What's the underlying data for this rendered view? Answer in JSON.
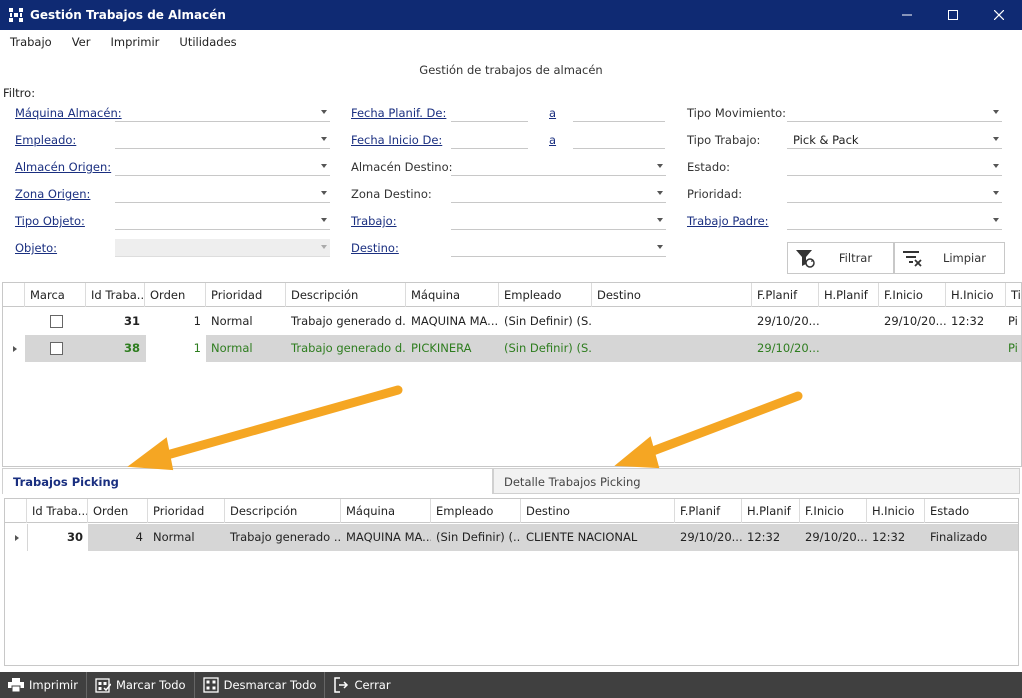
{
  "window": {
    "title": "Gestión Trabajos de Almacén"
  },
  "menu": [
    "Trabajo",
    "Ver",
    "Imprimir",
    "Utilidades"
  ],
  "form_title": "Gestión de trabajos de almacén",
  "filter": {
    "label": "Filtro:",
    "maquina_almacen": "Máquina Almacén:",
    "empleado": "Empleado:",
    "almacen_origen": "Almacén Origen:",
    "zona_origen": "Zona Origen:",
    "tipo_objeto": "Tipo Objeto:",
    "objeto": "Objeto:",
    "fecha_planif_de": "Fecha Planif. De:",
    "fecha_inicio_de": "Fecha Inicio De:",
    "a": "a",
    "almacen_destino": "Almacén Destino:",
    "zona_destino": "Zona Destino:",
    "trabajo": "Trabajo:",
    "destino": "Destino:",
    "tipo_movimiento": "Tipo Movimiento:",
    "tipo_trabajo": "Tipo Trabajo:",
    "tipo_trabajo_value": "Pick & Pack",
    "estado": "Estado:",
    "prioridad": "Prioridad:",
    "trabajo_padre": "Trabajo Padre:",
    "filtrar": "Filtrar",
    "limpiar": "Limpiar"
  },
  "top_grid": {
    "headers": [
      "Marca",
      "Id Traba...",
      "Orden",
      "Prioridad",
      "Descripción",
      "Máquina",
      "Empleado",
      "Destino",
      "F.Planif",
      "H.Planif",
      "F.Inicio",
      "H.Inicio",
      "Ti"
    ],
    "rows": [
      {
        "id": "31",
        "orden": "1",
        "prioridad": "Normal",
        "descripcion": "Trabajo generado d...",
        "maquina": "MAQUINA MA...",
        "empleado": "(Sin Definir) (S...",
        "destino": "",
        "f_planif": "29/10/20...",
        "h_planif": "",
        "f_inicio": "29/10/20...",
        "h_inicio": "12:32",
        "ti": "Pi"
      },
      {
        "id": "38",
        "orden": "1",
        "prioridad": "Normal",
        "descripcion": "Trabajo generado d...",
        "maquina": "PICKINERA",
        "empleado": "(Sin Definir) (S...",
        "destino": "",
        "f_planif": "29/10/20...",
        "h_planif": "",
        "f_inicio": "",
        "h_inicio": "",
        "ti": "Pi"
      }
    ]
  },
  "tabs": [
    "Trabajos Picking",
    "Detalle Trabajos Picking"
  ],
  "bottom_grid": {
    "headers": [
      "Id Traba...",
      "Orden",
      "Prioridad",
      "Descripción",
      "Máquina",
      "Empleado",
      "Destino",
      "F.Planif",
      "H.Planif",
      "F.Inicio",
      "H.Inicio",
      "Estado"
    ],
    "rows": [
      {
        "id": "30",
        "orden": "4",
        "prioridad": "Normal",
        "descripcion": "Trabajo generado ...",
        "maquina": "MAQUINA MA...",
        "empleado": "(Sin Definir) (...",
        "destino": "CLIENTE NACIONAL",
        "f_planif": "29/10/20...",
        "h_planif": "12:32",
        "f_inicio": "29/10/20...",
        "h_inicio": "12:32",
        "estado": "Finalizado"
      }
    ]
  },
  "bottom_bar": [
    "Imprimir",
    "Marcar Todo",
    "Desmarcar Todo",
    "Cerrar"
  ],
  "colors": {
    "titlebar": "#0f2a73",
    "link": "#1a2f80",
    "green_row": "#2e7d1f",
    "bottom_bar": "#404040",
    "arrow": "#f5a623"
  }
}
